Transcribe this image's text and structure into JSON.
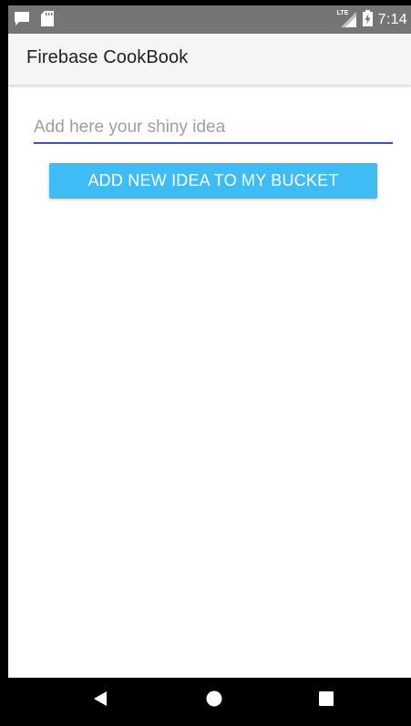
{
  "status_bar": {
    "time": "7:14",
    "network_label": "LTE",
    "icons": [
      "notification-icon",
      "sd-card-icon",
      "lte-signal-icon",
      "battery-charging-icon"
    ]
  },
  "app_bar": {
    "title": "Firebase CookBook"
  },
  "idea_form": {
    "input_value": "",
    "input_placeholder": "Add here your shiny idea",
    "add_button_label": "ADD NEW IDEA TO MY BUCKET"
  },
  "nav_bar": {
    "icons": [
      "back-icon",
      "home-icon",
      "recents-icon"
    ]
  },
  "colors": {
    "status_bar": "#757575",
    "app_bar": "#f5f5f5",
    "input_underline": "#3f51b5",
    "button": "#3fbcf6",
    "nav_bar": "#000000"
  }
}
